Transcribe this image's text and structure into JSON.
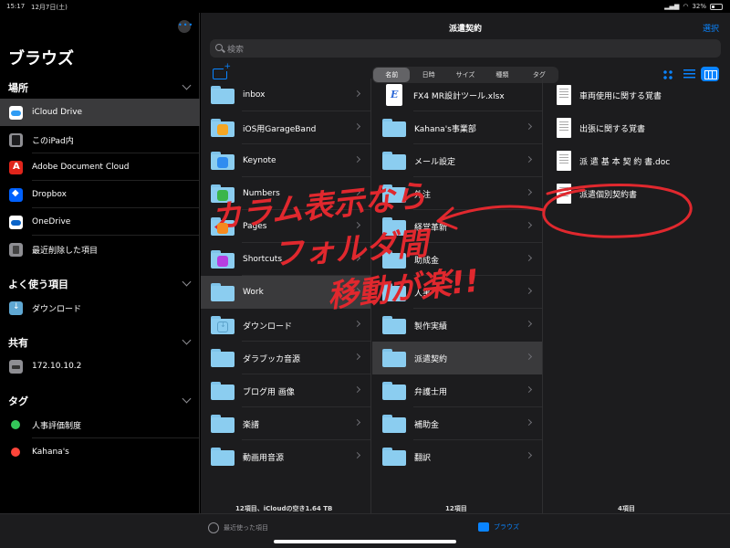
{
  "status": {
    "time": "15:17",
    "date": "12月7日(土)",
    "battery": "32%",
    "battery_level": 0.32
  },
  "sidebar": {
    "title": "ブラウズ",
    "sections": {
      "places": "場所",
      "favorites": "よく使う項目",
      "shared": "共有",
      "tags": "タグ"
    },
    "places": [
      {
        "label": "iCloud Drive",
        "icon": "icloud-icon",
        "selected": true
      },
      {
        "label": "このiPad内",
        "icon": "ipad-icon"
      },
      {
        "label": "Adobe Document Cloud",
        "icon": "adobe-icon"
      },
      {
        "label": "Dropbox",
        "icon": "dropbox-icon"
      },
      {
        "label": "OneDrive",
        "icon": "onedrive-icon"
      },
      {
        "label": "最近削除した項目",
        "icon": "trash-icon"
      }
    ],
    "favorites": [
      {
        "label": "ダウンロード",
        "icon": "download-folder-icon"
      }
    ],
    "shared": [
      {
        "label": "172.10.10.2",
        "icon": "server-icon"
      }
    ],
    "tags": [
      {
        "label": "人事評価制度",
        "color": "#34c759"
      },
      {
        "label": "Kahana's",
        "color": "#ff453a"
      }
    ]
  },
  "main": {
    "title": "派遣契約",
    "select_label": "選択",
    "search_placeholder": "検索",
    "sort_tabs": [
      "名前",
      "日時",
      "サイズ",
      "種類",
      "タグ"
    ],
    "sort_selected": "名前"
  },
  "columns": {
    "col1": {
      "items": [
        "inbox",
        "iOS用GarageBand",
        "Keynote",
        "Numbers",
        "Pages",
        "Shortcuts",
        "Work",
        "ダウンロード",
        "ダラブッカ音源",
        "ブログ用 画像",
        "楽譜",
        "動画用音源"
      ],
      "count": "12項目、iCloudの空き1.64 TB"
    },
    "col2": {
      "items": [
        "FX4 MR設計ツール.xlsx",
        "Kahana's事業部",
        "メール設定",
        "外注",
        "経営革新",
        "助成金",
        "人事",
        "製作実績",
        "派遣契約",
        "弁護士用",
        "補助金",
        "翻訳"
      ],
      "count": "12項目"
    },
    "col3": {
      "items": [
        "車両使用に関する覚書",
        "出張に関する覚書",
        "派 遣 基 本 契 約 書.doc",
        "派遣個別契約書"
      ],
      "count": "4項目"
    }
  },
  "tabbar": {
    "recent": "最近使った項目",
    "browse": "ブラウズ"
  },
  "annotation": {
    "line1": "カラム表示なら",
    "line2": "フォルダ間",
    "line3": "移動が楽!!",
    "color": "#e0282e"
  }
}
